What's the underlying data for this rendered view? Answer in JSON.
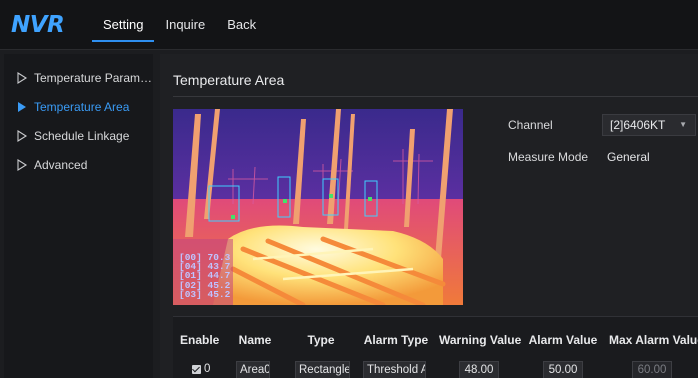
{
  "app": {
    "logo": "NVR"
  },
  "nav": {
    "items": [
      "Setting",
      "Inquire",
      "Back"
    ],
    "active": 0
  },
  "sidebar": {
    "items": [
      {
        "label": "Temperature Param…",
        "active": false
      },
      {
        "label": "Temperature Area",
        "active": true
      },
      {
        "label": "Schedule Linkage",
        "active": false
      },
      {
        "label": "Advanced",
        "active": false
      }
    ]
  },
  "page": {
    "title": "Temperature Area"
  },
  "preview": {
    "readings": [
      "[00] 70.3",
      "[04] 43.7",
      "[01] 44.7",
      "[02] 45.2",
      "[03] 45.2"
    ]
  },
  "form": {
    "channel_label": "Channel",
    "channel_value": "[2]6406KT",
    "measure_mode_label": "Measure Mode",
    "measure_mode_value": "General"
  },
  "table": {
    "headers": [
      "Enable",
      "Name",
      "Type",
      "Alarm Type",
      "Warning Value",
      "Alarm Value",
      "Max Alarm Value"
    ],
    "rows": [
      {
        "enabled": true,
        "index": "0",
        "name": "Area0",
        "type": "Rectangle",
        "alarm_type": "Threshold Ala",
        "warning_value": "48.00",
        "alarm_value": "50.00",
        "max_alarm_value": "60.00"
      }
    ]
  },
  "colors": {
    "accent": "#2e8ff0",
    "logo": "#3fa3ff",
    "background": "#1c1d20"
  },
  "icons": {
    "sidebar_inactive": "triangle-outline-right-icon",
    "sidebar_active": "triangle-filled-right-icon",
    "select_caret": "caret-down-icon"
  }
}
